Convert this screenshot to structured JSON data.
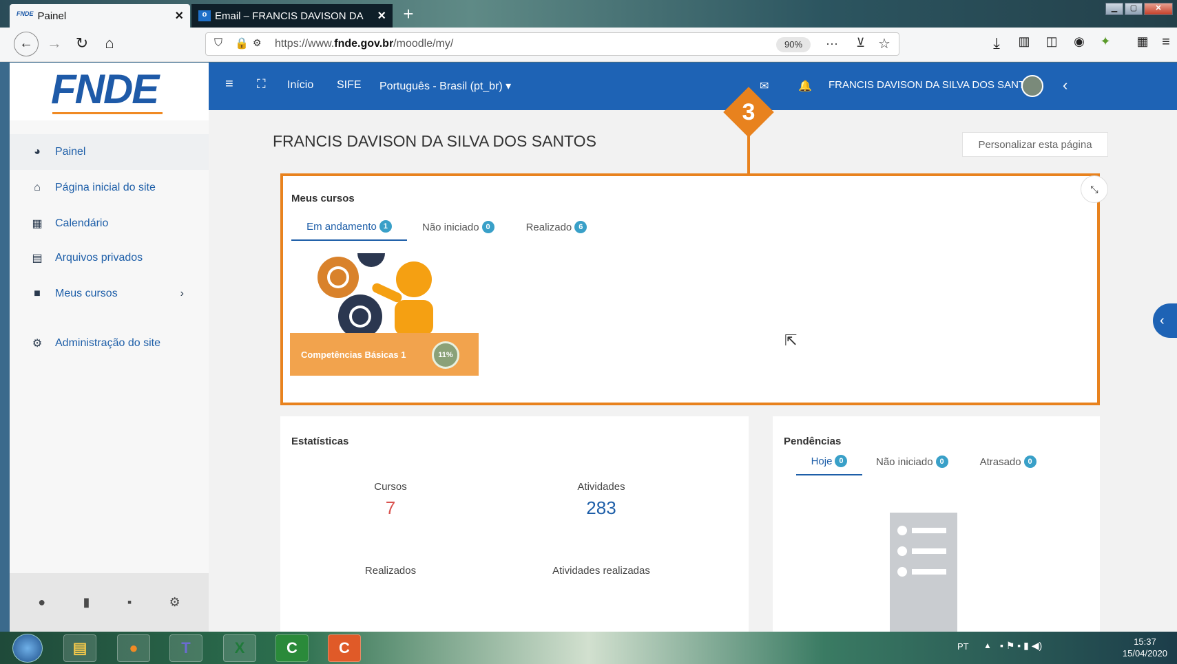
{
  "browser": {
    "tabs": [
      {
        "favicon": "FNDE",
        "title": "Painel",
        "close": "×"
      },
      {
        "favicon": "o",
        "title": "Email – FRANCIS DAVISON DA",
        "close": "×"
      }
    ],
    "new_tab": "+",
    "url_prefix": "https://www.",
    "url_domain": "fnde.gov.br",
    "url_path": "/moodle/my/",
    "zoom": "90%"
  },
  "site": {
    "logo": "FNDE",
    "topbar": {
      "inicio": "Início",
      "sife": "SIFE",
      "language": "Português - Brasil (pt_br) ▾",
      "user_name": "FRANCIS DAVISON DA SILVA DOS SANTOS"
    },
    "sidebar": {
      "items": [
        {
          "label": "Painel",
          "icon": "dashboard-icon"
        },
        {
          "label": "Página inicial do site",
          "icon": "home-icon"
        },
        {
          "label": "Calendário",
          "icon": "calendar-icon"
        },
        {
          "label": "Arquivos privados",
          "icon": "files-icon"
        },
        {
          "label": "Meus cursos",
          "icon": "courses-icon"
        },
        {
          "label": "Administração do site",
          "icon": "gear-icon"
        }
      ]
    }
  },
  "main": {
    "title": "FRANCIS DAVISON DA SILVA DOS SANTOS",
    "customize": "Personalizar esta página",
    "callout_number": "3",
    "courses": {
      "title": "Meus cursos",
      "tabs": [
        {
          "label": "Em andamento",
          "count": "1"
        },
        {
          "label": "Não iniciado",
          "count": "0"
        },
        {
          "label": "Realizado",
          "count": "6"
        }
      ],
      "course_name": "Competências Básicas 1",
      "course_progress": "11%"
    },
    "stats": {
      "title": "Estatísticas",
      "cursos_label": "Cursos",
      "cursos_value": "7",
      "atividades_label": "Atividades",
      "atividades_value": "283",
      "realizados_label": "Realizados",
      "atividades_realizadas_label": "Atividades realizadas"
    },
    "pendencias": {
      "title": "Pendências",
      "tabs": [
        {
          "label": "Hoje",
          "count": "0"
        },
        {
          "label": "Não iniciado",
          "count": "0"
        },
        {
          "label": "Atrasado",
          "count": "0"
        }
      ]
    }
  },
  "taskbar": {
    "lang": "PT",
    "time": "15:37",
    "date": "15/04/2020"
  },
  "colors": {
    "brand_blue": "#1e63b5",
    "accent_orange": "#e8821e"
  }
}
